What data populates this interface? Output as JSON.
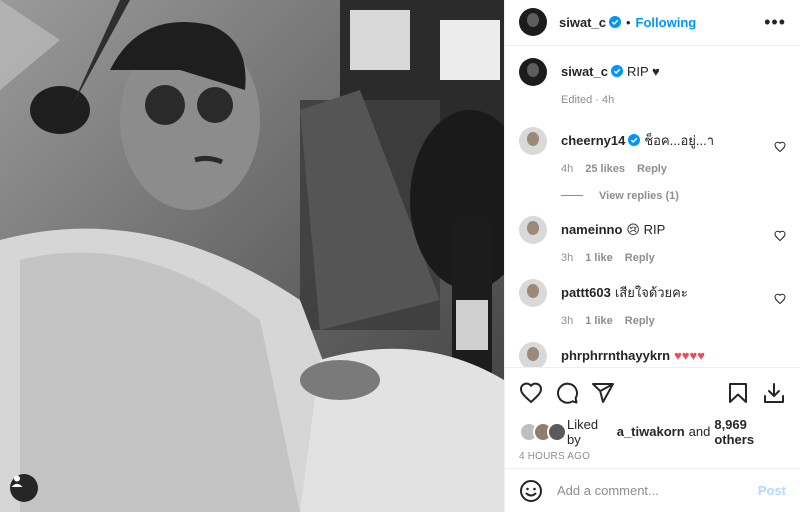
{
  "header": {
    "username": "siwat_c",
    "separator": "•",
    "follow_label": "Following",
    "more_label": "•••"
  },
  "caption": {
    "username": "siwat_c",
    "text": "RIP ♥",
    "edited": "Edited · 4h"
  },
  "comments": [
    {
      "username": "cheerny14",
      "verified": true,
      "text": "ช็อค...อยู่...า",
      "time": "4h",
      "likes": "25 likes",
      "reply": "Reply"
    },
    {
      "username": "nameinno",
      "verified": false,
      "text": "😢 RIP",
      "time": "3h",
      "likes": "1 like",
      "reply": "Reply"
    },
    {
      "username": "pattt603",
      "verified": false,
      "text": "เสียใจด้วยคะ",
      "time": "3h",
      "likes": "1 like",
      "reply": "Reply"
    },
    {
      "username": "phrphrrnthayykrn",
      "verified": false,
      "text": "♥♥♥♥",
      "time": "",
      "likes": "",
      "reply": ""
    }
  ],
  "view_replies": "View replies (1)",
  "likes": {
    "prefix": "Liked by",
    "user": "a_tiwakorn",
    "and": "and",
    "others": "8,969 others"
  },
  "timestamp": "4 HOURS AGO",
  "add_comment": {
    "placeholder": "Add a comment...",
    "post_label": "Post"
  },
  "colors": {
    "accent": "#0095f6",
    "muted": "#8e8e8e",
    "like_red": "#ed4956"
  },
  "icons": [
    "verified-badge-icon",
    "heart-icon",
    "comment-icon",
    "share-icon",
    "bookmark-icon",
    "download-icon",
    "emoji-icon",
    "tag-user-icon"
  ]
}
